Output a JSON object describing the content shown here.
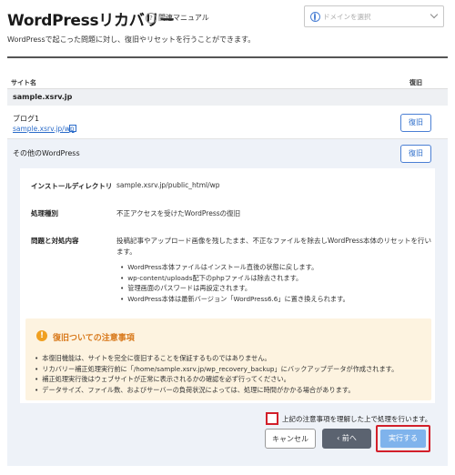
{
  "header": {
    "title": "WordPressリカバリー",
    "help_icon": "?",
    "help_link": "関連マニュアル",
    "domain_select_placeholder": "ドメインを選択",
    "description": "WordPressで起こった問題に対し、復旧やリセットを行うことができます。"
  },
  "table": {
    "col_site": "サイト名",
    "col_restore": "復旧",
    "domain": "sample.xsrv.jp",
    "rows": [
      {
        "label": "ブログ1",
        "url": "sample.xsrv.jp/wp",
        "button": "復旧"
      },
      {
        "label": "その他のWordPress",
        "button": "復旧"
      }
    ]
  },
  "details": {
    "install_dir_key": "インストールディレクトリ",
    "install_dir_val": "sample.xsrv.jp/public_html/wp",
    "type_key": "処理種別",
    "type_val": "不正アクセスを受けたWordPressの復旧",
    "content_key": "問題と対処内容",
    "content_val": "投稿記事やアップロード画像を残したまま、不正なファイルを除去しWordPress本体のリセットを行います。",
    "bullets": [
      "WordPress本体ファイルはインストール直後の状態に戻します。",
      "wp-content/uploads配下のphpファイルは除去されます。",
      "管理画面のパスワードは再設定されます。",
      "WordPress本体は最新バージョン「WordPress6.6」に置き換えられます。"
    ]
  },
  "warning": {
    "icon": "!",
    "title": "復旧ついての注意事項",
    "items": [
      "本復旧機能は、サイトを完全に復旧することを保証するものではありません。",
      "リカバリー補正処理実行前に「/home/sample.xsrv.jp/wp_recovery_backup」にバックアップデータが作成されます。",
      "補正処理実行後はウェブサイトが正常に表示されるかの確認を必ず行ってください。",
      "データサイズ、ファイル数、およびサーバーの負荷状況によっては、処理に時間がかかる場合があります。"
    ]
  },
  "confirm": {
    "checkbox_label": "上記の注意事項を理解した上で処理を行います。"
  },
  "buttons": {
    "cancel": "キャンセル",
    "back": "前へ",
    "back_icon": "‹",
    "execute": "実行する"
  },
  "colors": {
    "accent": "#2a6bc9",
    "warning": "#d8781a",
    "highlight": "#d21f2a",
    "execute_disabled": "#7fb3ec"
  }
}
